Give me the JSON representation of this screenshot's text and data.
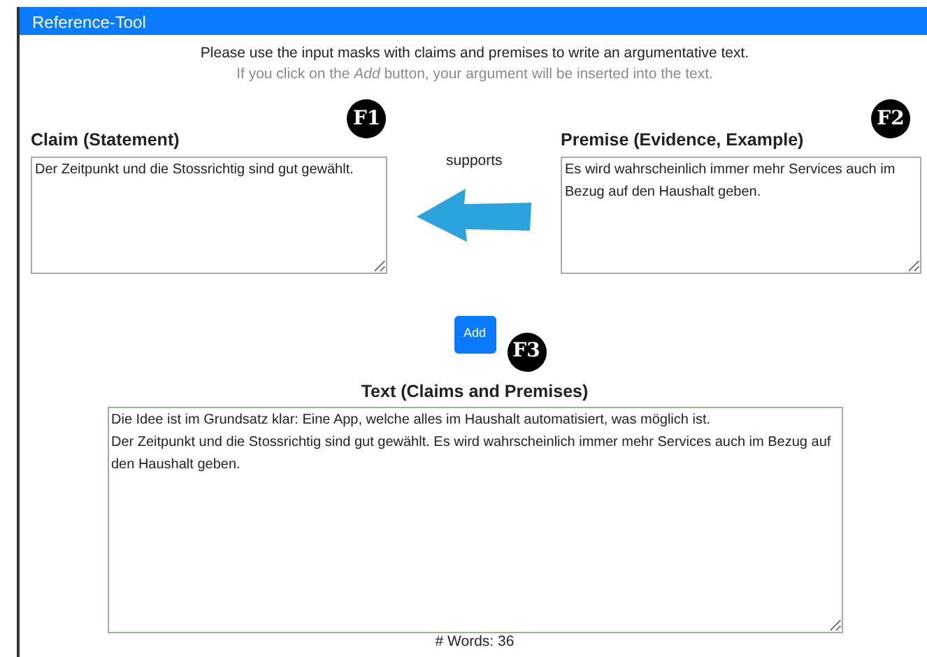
{
  "window": {
    "title": "Reference-Tool"
  },
  "intro": {
    "line_1": "Please use the input masks with claims and premises to write an argumentative text.",
    "line_2": "If you click on the *Add* button, your argument will be inserted into the text."
  },
  "claim": {
    "heading": "Claim (Statement)",
    "value": "Der Zeitpunkt und die Stossrichtig sind gut gewählt.",
    "marker": "F1"
  },
  "relation": {
    "label": "supports"
  },
  "premise": {
    "heading": "Premise (Evidence, Example)",
    "value": "Es wird wahrscheinlich immer mehr Services auch im Bezug auf den Haushalt geben.",
    "marker": "F2"
  },
  "add_button": {
    "label": "Add",
    "marker": "F3"
  },
  "text": {
    "heading": "Text (Claims and Premises)",
    "value": "Die Idee ist im Grundsatz klar: Eine App, welche alles im Haushalt automatisiert, was möglich ist.\nDer Zeitpunkt und die Stossrichtig sind gut gewählt. Es wird wahrscheinlich immer mehr Services auch im Bezug auf den Haushalt geben.",
    "word_count": "# Words: 36"
  }
}
